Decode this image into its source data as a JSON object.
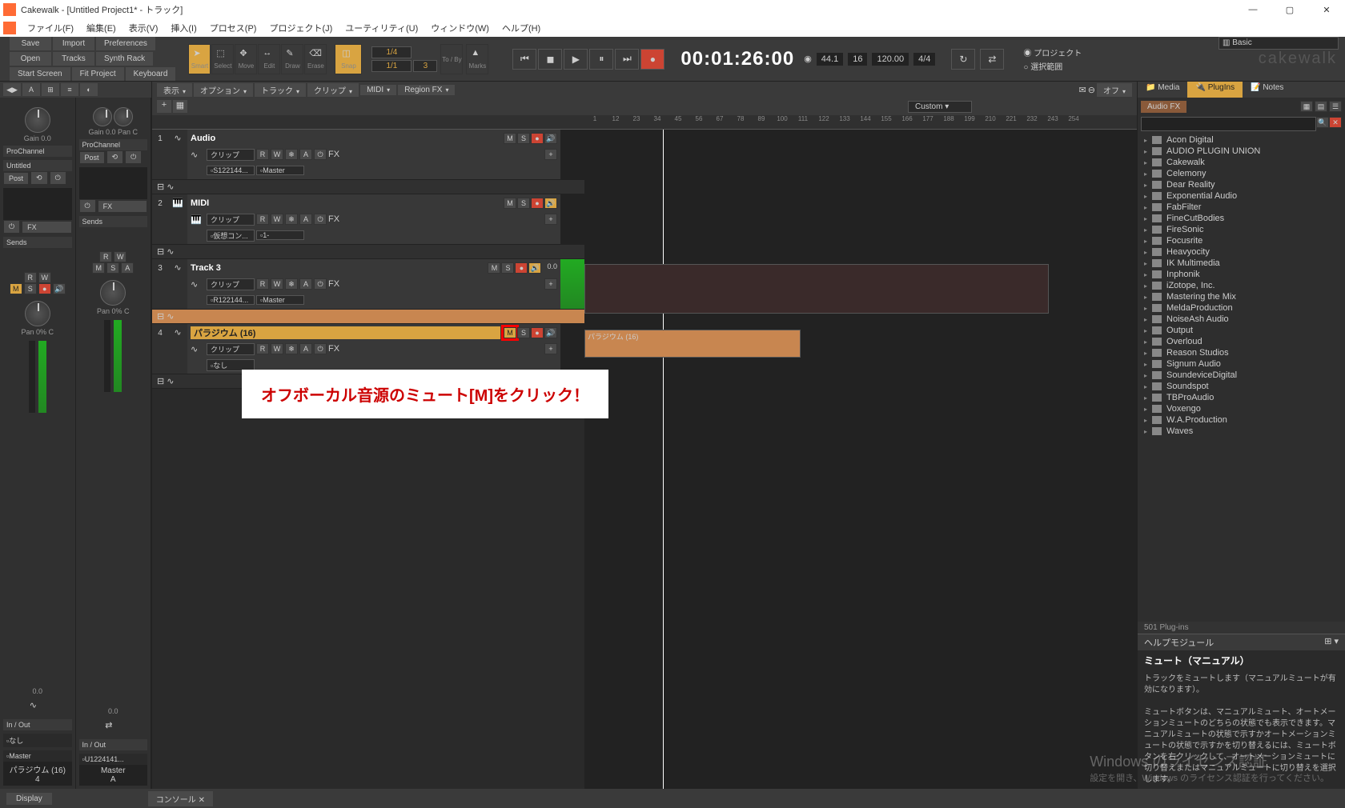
{
  "title": "Cakewalk - [Untitled Project1* - トラック]",
  "menu": [
    "ファイル(F)",
    "編集(E)",
    "表示(V)",
    "挿入(I)",
    "プロセス(P)",
    "プロジェクト(J)",
    "ユーティリティ(U)",
    "ウィンドウ(W)",
    "ヘルプ(H)"
  ],
  "workspace": "Basic",
  "toolbar_buttons": {
    "save": "Save",
    "import": "Import",
    "prefs": "Preferences",
    "open": "Open",
    "tracks": "Tracks",
    "synth": "Synth Rack",
    "start": "Start Screen",
    "fit": "Fit Project",
    "kbd": "Keyboard"
  },
  "tools": [
    "Smart",
    "Select",
    "Move",
    "Edit",
    "Draw",
    "Erase"
  ],
  "snap": {
    "label": "Snap",
    "top": "1/4",
    "bottom_l": "1/1",
    "bottom_r": "3"
  },
  "marks": "Marks",
  "to_by": "To / By",
  "timecode": "00:01:26:00",
  "tempo": {
    "rate": "44.1",
    "bits": "16",
    "bpm": "120.00",
    "sig": "4/4"
  },
  "aim": {
    "project": "プロジェクト",
    "selection": "選択範囲"
  },
  "track_toolbar": [
    "表示",
    "オプション",
    "トラック",
    "クリップ",
    "MIDI",
    "Region FX"
  ],
  "track_toolbar_right": "オフ",
  "track_header": {
    "custom": "Custom"
  },
  "ruler": [
    "1",
    "12",
    "23",
    "34",
    "45",
    "56",
    "67",
    "78",
    "89",
    "100",
    "111",
    "122",
    "133",
    "144",
    "155",
    "166",
    "177",
    "188",
    "199",
    "210",
    "221",
    "232",
    "243",
    "254"
  ],
  "tracks": [
    {
      "num": "1",
      "name": "Audio",
      "clip": "クリップ",
      "src": "S122144...",
      "out": "Master",
      "mute": false,
      "fx": "FX"
    },
    {
      "num": "2",
      "name": "MIDI",
      "clip": "クリップ",
      "src": "仮想コン...",
      "out": "1-",
      "mute": false,
      "fx": "FX"
    },
    {
      "num": "3",
      "name": "Track 3",
      "clip": "クリップ",
      "src": "R122144...",
      "out": "Master",
      "vol": "0.0",
      "mute": false,
      "fx": "FX"
    },
    {
      "num": "4",
      "name": "パラジウム (16)",
      "clip": "クリップ",
      "src": "なし",
      "out": "",
      "mute": true,
      "fx": "FX"
    }
  ],
  "clip_label": "パラジウム (16)",
  "callout": "オフボーカル音源のミュート[M]をクリック！",
  "inspector": {
    "gain_l": "Gain  0.0",
    "gain_r": "Gain  0.0",
    "pan_r": "Pan  C",
    "prochannel": "ProChannel",
    "untitled": "Untitled",
    "post": "Post",
    "fx": "FX",
    "sends": "Sends",
    "pan": "Pan 0% C",
    "inout": "In / Out",
    "none": "なし",
    "master": "Master",
    "u": "U1224141...",
    "foot_l": "パラジウム (16)",
    "foot_l2": "4",
    "foot_r": "Master",
    "foot_r2": "A",
    "letters": {
      "r": "R",
      "w": "W",
      "m": "M",
      "s": "S",
      "a": "A"
    },
    "zero": "0.0"
  },
  "browser": {
    "tabs": {
      "media": "Media",
      "plugins": "PlugIns",
      "notes": "Notes"
    },
    "sub": "Audio FX",
    "plugins": [
      "Acon Digital",
      "AUDIO PLUGIN UNION",
      "Cakewalk",
      "Celemony",
      "Dear Reality",
      "Exponential Audio",
      "FabFilter",
      "FineCutBodies",
      "FireSonic",
      "Focusrite",
      "Heavyocity",
      "IK Multimedia",
      "Inphonik",
      "iZotope, Inc.",
      "Mastering the Mix",
      "MeldaProduction",
      "NoiseAsh Audio",
      "Output",
      "Overloud",
      "Reason Studios",
      "Signum Audio",
      "SoundeviceDigital",
      "Soundspot",
      "TBProAudio",
      "Voxengo",
      "W.A.Production",
      "Waves"
    ],
    "count": "501 Plug-ins"
  },
  "help": {
    "header": "ヘルプモジュール",
    "title": "ミュート（マニュアル）",
    "body1": "トラックをミュートします（マニュアルミュートが有効になります）。",
    "body2": "ミュートボタンは、マニュアルミュート、オートメーションミュートのどちらの状態でも表示できます。マニュアルミュートの状態で示すかオートメーションミュートの状態で示すかを切り替えるには、ミュートボタンを右クリックして、オートメーションミュートに切り替えまたはマニュアルミュートに切り替えを選択します。"
  },
  "status": {
    "display": "Display",
    "console": "コンソール"
  },
  "watermark": {
    "l1": "Windows のライセンス認証",
    "l2": "設定を開き、Windows のライセンス認証を行ってください。"
  }
}
